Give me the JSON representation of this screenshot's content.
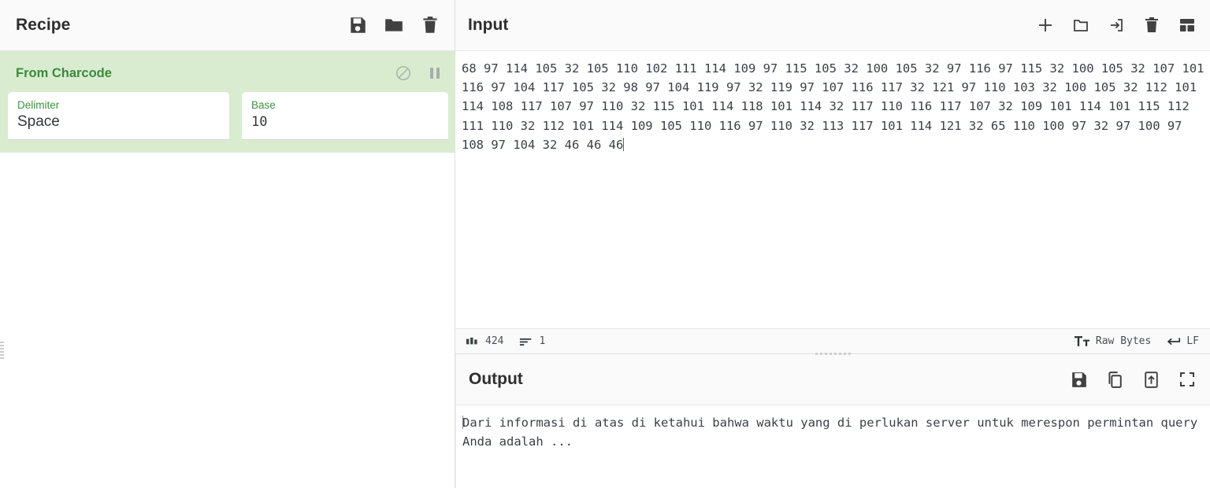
{
  "recipe": {
    "title": "Recipe",
    "actions": [
      {
        "name": "save-recipe-icon",
        "icon": "floppy-disk"
      },
      {
        "name": "load-recipe-icon",
        "icon": "folder"
      },
      {
        "name": "clear-recipe-icon",
        "icon": "trash"
      }
    ],
    "operation": {
      "name": "From Charcode",
      "disable_icon": "circle-slash",
      "breakpoint_icon": "pause",
      "args": [
        {
          "label": "Delimiter",
          "value": "Space",
          "mono": false
        },
        {
          "label": "Base",
          "value": "10",
          "mono": true
        }
      ]
    }
  },
  "input": {
    "title": "Input",
    "actions": [
      {
        "name": "add-input-tab-icon",
        "icon": "plus"
      },
      {
        "name": "open-folder-icon",
        "icon": "folder-outline"
      },
      {
        "name": "open-file-icon",
        "icon": "import-arrow"
      },
      {
        "name": "clear-input-icon",
        "icon": "trash"
      },
      {
        "name": "tab-layout-icon",
        "icon": "layout"
      }
    ],
    "text": "68 97 114 105 32 105 110 102 111 114 109 97 115 105 32 100 105 32 97 116 97 115 32 100 105 32 107 101 116 97 104 117 105 32 98 97 104 119 97 32 119 97 107 116 117 32 121 97 110 103 32 100 105 32 112 101 114 108 117 107 97 110 32 115 101 114 118 101 114 32 117 110 116 117 107 32 109 101 114 101 115 112 111 110 32 112 101 114 109 105 110 116 97 110 32 113 117 101 114 121 32 65 110 100 97 32 97 100 97 108 97 104 32 46 46 46",
    "status": {
      "length_icon": "abc",
      "length": "424",
      "lines_icon": "lines",
      "lines": "1",
      "encoding_icon": "font-size",
      "encoding": "Raw Bytes",
      "eol_icon": "return-arrow",
      "eol": "LF"
    }
  },
  "output": {
    "title": "Output",
    "actions": [
      {
        "name": "save-output-icon",
        "icon": "floppy-disk"
      },
      {
        "name": "copy-output-icon",
        "icon": "copy"
      },
      {
        "name": "replace-input-icon",
        "icon": "export-arrow"
      },
      {
        "name": "maximise-output-icon",
        "icon": "fullscreen"
      }
    ],
    "text": "Dari informasi di atas di ketahui bahwa waktu yang di perlukan server untuk merespon permintan query Anda adalah ..."
  },
  "colors": {
    "operation_bg": "#d9ecd0",
    "operation_title": "#3a8b3a",
    "arg_label": "#3e9142",
    "panel_header_bg": "#fafafa",
    "text": "#2e2e2e"
  }
}
